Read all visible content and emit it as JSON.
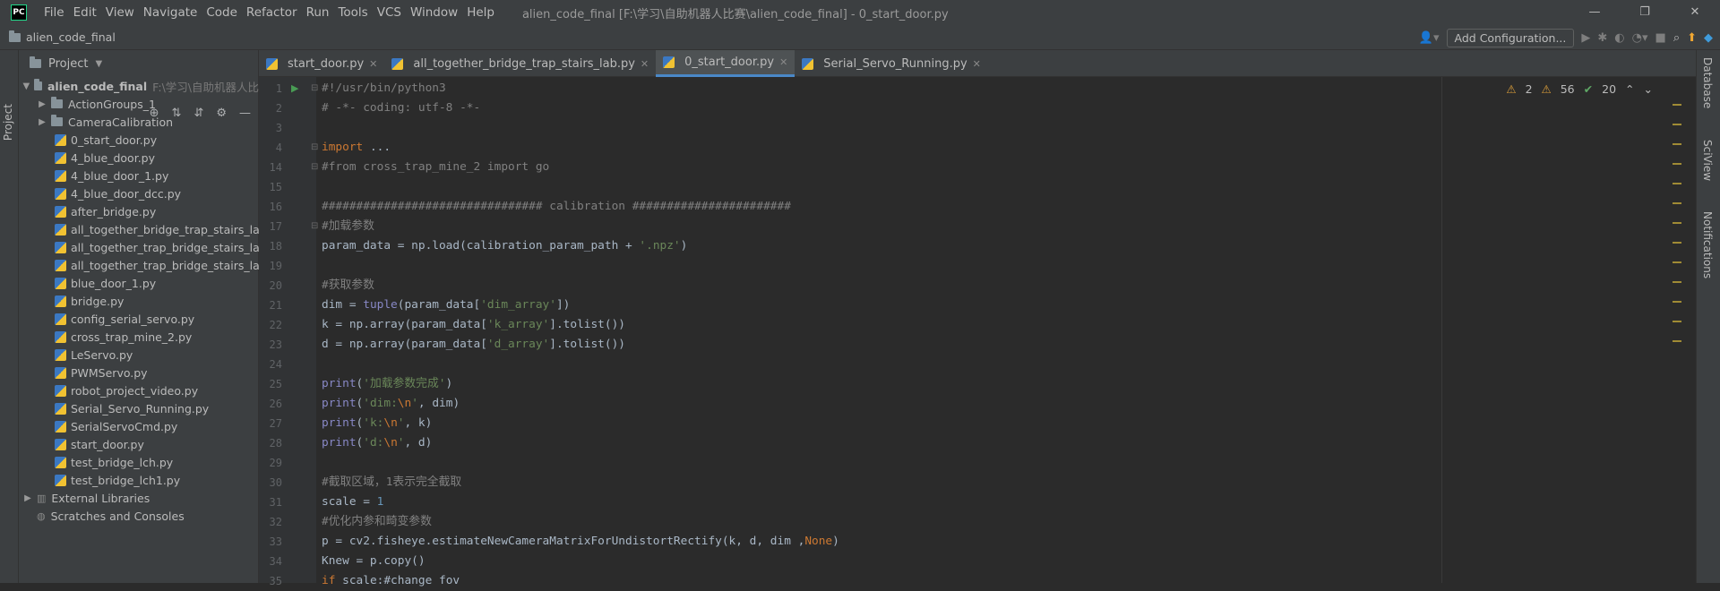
{
  "titlebar": {
    "menu": [
      "File",
      "Edit",
      "View",
      "Navigate",
      "Code",
      "Refactor",
      "Run",
      "Tools",
      "VCS",
      "Window",
      "Help"
    ],
    "title": "alien_code_final [F:\\学习\\自助机器人比赛\\alien_code_final] - 0_start_door.py",
    "minimize": "—",
    "maximize": "❐",
    "close": "✕",
    "logo": "PC"
  },
  "navbar": {
    "project": "alien_code_final",
    "add_config": "Add Configuration..."
  },
  "left_strip": {
    "project_tab": "Project"
  },
  "project_panel": {
    "title": "Project",
    "root": {
      "name": "alien_code_final",
      "path": "F:\\学习\\自助机器人比"
    },
    "folders": [
      "ActionGroups_1",
      "CameraCalibration"
    ],
    "files": [
      "0_start_door.py",
      "4_blue_door.py",
      "4_blue_door_1.py",
      "4_blue_door_dcc.py",
      "after_bridge.py",
      "all_together_bridge_trap_stairs_lab.",
      "all_together_trap_bridge_stairs_lab.",
      "all_together_trap_bridge_stairs_lab_",
      "blue_door_1.py",
      "bridge.py",
      "config_serial_servo.py",
      "cross_trap_mine_2.py",
      "LeServo.py",
      "PWMServo.py",
      "robot_project_video.py",
      "Serial_Servo_Running.py",
      "SerialServoCmd.py",
      "start_door.py",
      "test_bridge_lch.py",
      "test_bridge_lch1.py"
    ],
    "external": "External Libraries",
    "scratches": "Scratches and Consoles"
  },
  "tabs": [
    "start_door.py",
    "all_together_bridge_trap_stairs_lab.py",
    "0_start_door.py",
    "Serial_Servo_Running.py"
  ],
  "inspections": {
    "warnings": "2",
    "weak": "56",
    "ok": "20"
  },
  "right_strip": [
    "Database",
    "SciView",
    "Notifications"
  ],
  "lines": [
    {
      "n": "1",
      "t": "#!/usr/bin/python3"
    },
    {
      "n": "2",
      "t": "# -*- coding: utf-8 -*-"
    },
    {
      "n": "3",
      "t": ""
    },
    {
      "n": "4",
      "t": "import ..."
    },
    {
      "n": "14",
      "t": "#from cross_trap_mine_2 import go"
    },
    {
      "n": "15",
      "t": ""
    },
    {
      "n": "16",
      "t": "################################ calibration #######################"
    },
    {
      "n": "17",
      "t": "#加载参数"
    },
    {
      "n": "18",
      "t": "param_data = np.load(calibration_param_path + '.npz')"
    },
    {
      "n": "19",
      "t": ""
    },
    {
      "n": "20",
      "t": "#获取参数"
    },
    {
      "n": "21",
      "t": "dim = tuple(param_data['dim_array'])"
    },
    {
      "n": "22",
      "t": "k = np.array(param_data['k_array'].tolist())"
    },
    {
      "n": "23",
      "t": "d = np.array(param_data['d_array'].tolist())"
    },
    {
      "n": "24",
      "t": ""
    },
    {
      "n": "25",
      "t": "print('加载参数完成')"
    },
    {
      "n": "26",
      "t": "print('dim:\\n', dim)"
    },
    {
      "n": "27",
      "t": "print('k:\\n', k)"
    },
    {
      "n": "28",
      "t": "print('d:\\n', d)"
    },
    {
      "n": "29",
      "t": ""
    },
    {
      "n": "30",
      "t": "#截取区域，1表示完全截取"
    },
    {
      "n": "31",
      "t": "scale = 1"
    },
    {
      "n": "32",
      "t": "#优化内参和畸变参数"
    },
    {
      "n": "33",
      "t": "p = cv2.fisheye.estimateNewCameraMatrixForUndistortRectify(k, d, dim ,None)"
    },
    {
      "n": "34",
      "t": "Knew = p.copy()"
    },
    {
      "n": "35",
      "t": "if scale:#change fov"
    }
  ]
}
